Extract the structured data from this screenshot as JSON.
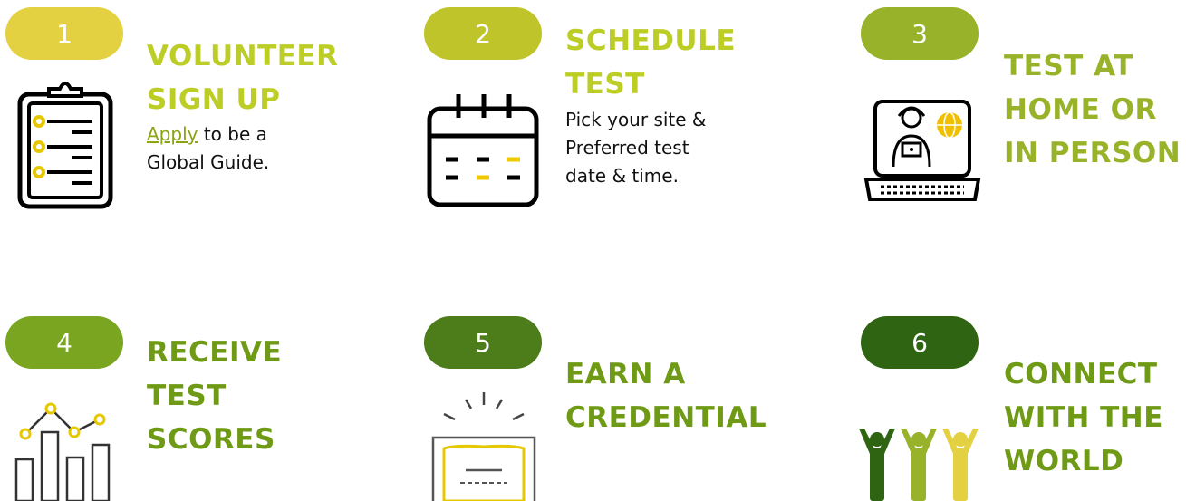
{
  "colors": {
    "step1": "#e4d142",
    "step2": "#bfc42a",
    "step3": "#98b22a",
    "step4": "#79a521",
    "step5": "#4d7c1b",
    "step6": "#2f6512",
    "title_top": "#bccd26",
    "title_bottom": "#6f9a16",
    "link": "#8aa412"
  },
  "steps": [
    {
      "number": "1",
      "title": "VOLUNTEER\nSIGN UP",
      "link_text": "Apply",
      "desc_rest": " to be a\nGlobal Guide.",
      "icon": "clipboard-checklist-icon"
    },
    {
      "number": "2",
      "title": "SCHEDULE\nTEST",
      "desc": "Pick your site &\nPreferred test\ndate & time.",
      "icon": "calendar-icon"
    },
    {
      "number": "3",
      "title": "TEST AT\nHOME OR\nIN PERSON",
      "icon": "laptop-remote-test-icon"
    },
    {
      "number": "4",
      "title": "RECEIVE\nTEST\nSCORES",
      "icon": "bar-line-chart-icon"
    },
    {
      "number": "5",
      "title": "EARN A\nCREDENTIAL",
      "icon": "certificate-icon"
    },
    {
      "number": "6",
      "title": "CONNECT\nWITH THE\nWORLD",
      "icon": "people-celebrating-icon"
    }
  ]
}
